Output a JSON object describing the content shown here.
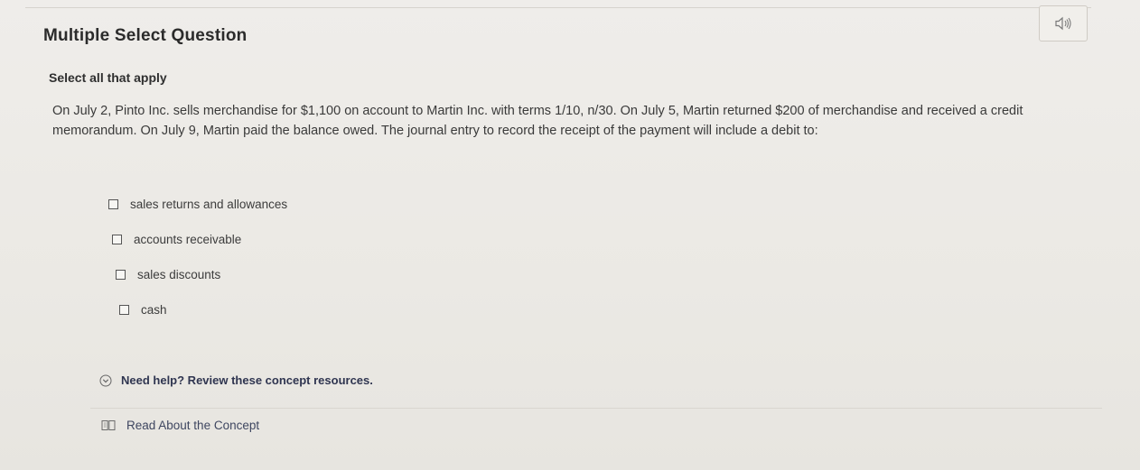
{
  "header": {
    "question_type": "Multiple Select Question",
    "audio_icon": "speaker-icon"
  },
  "question": {
    "instruction": "Select all that apply",
    "prompt": "On July 2, Pinto Inc. sells merchandise for $1,100 on account to Martin Inc. with terms 1/10, n/30. On July 5, Martin returned $200 of merchandise and received a credit memorandum. On July 9, Martin paid the balance owed. The journal entry to record the receipt of the payment will include a debit to:"
  },
  "options": [
    {
      "label": "sales returns and allowances",
      "checked": false
    },
    {
      "label": "accounts receivable",
      "checked": false
    },
    {
      "label": "sales discounts",
      "checked": false
    },
    {
      "label": "cash",
      "checked": false
    }
  ],
  "help": {
    "icon": "chevron-down-circle-icon",
    "text": "Need help? Review these concept resources."
  },
  "resources": {
    "icon": "book-icon",
    "read_label": "Read About the Concept"
  }
}
